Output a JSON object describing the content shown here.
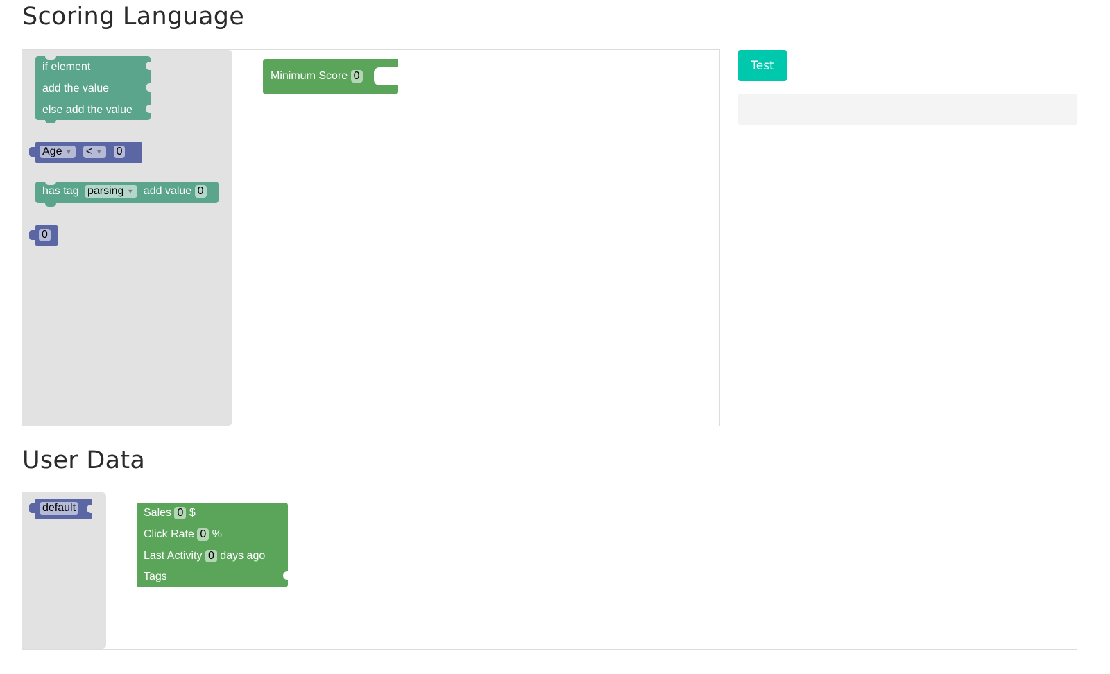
{
  "sections": {
    "scoring_title": "Scoring Language",
    "user_title": "User Data"
  },
  "scoring_toolbox": {
    "if_block": {
      "line1": "if element",
      "line2": "add the value",
      "line3": "else add the value"
    },
    "compare_block": {
      "field": "Age",
      "operator": "<",
      "value": "0"
    },
    "tag_block": {
      "prefix": "has tag",
      "tag": "parsing",
      "middle": "add value",
      "value": "0"
    },
    "number_block": {
      "value": "0"
    }
  },
  "scoring_canvas": {
    "min_score_block": {
      "label": "Minimum Score",
      "value": "0"
    }
  },
  "test_button": {
    "label": "Test",
    "color": "#00c8ad"
  },
  "user_toolbox": {
    "default_block": {
      "label": "default"
    }
  },
  "user_canvas": {
    "user_block": {
      "sales_label": "Sales",
      "sales_value": "0",
      "sales_unit": "$",
      "click_label": "Click Rate",
      "click_value": "0",
      "click_unit": "%",
      "activity_label": "Last Activity",
      "activity_value": "0",
      "activity_unit": "days ago",
      "tags_label": "Tags"
    }
  },
  "colors": {
    "logic_block": "#5ba58c",
    "value_block": "#5b67a5",
    "data_block": "#5ba55b",
    "toolbox_bg": "#e2e2e2"
  }
}
